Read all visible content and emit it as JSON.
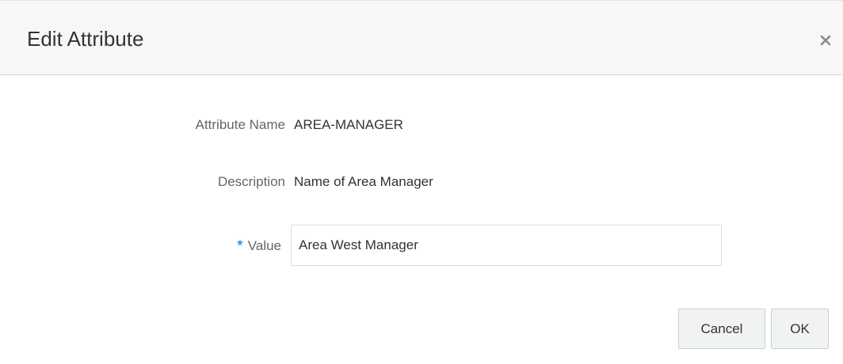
{
  "dialog": {
    "title": "Edit Attribute",
    "close_icon": "close-icon"
  },
  "form": {
    "attribute_name_label": "Attribute Name",
    "attribute_name_value": "AREA-MANAGER",
    "description_label": "Description",
    "description_value": "Name of Area Manager",
    "value_required_marker": "*",
    "value_label": "Value",
    "value_input": "Area West Manager"
  },
  "buttons": {
    "cancel_label": "Cancel",
    "ok_label": "OK"
  },
  "colors": {
    "header_background": "#f7f7f7",
    "required_marker": "#1a78c2",
    "button_background": "#f1f3f3"
  }
}
